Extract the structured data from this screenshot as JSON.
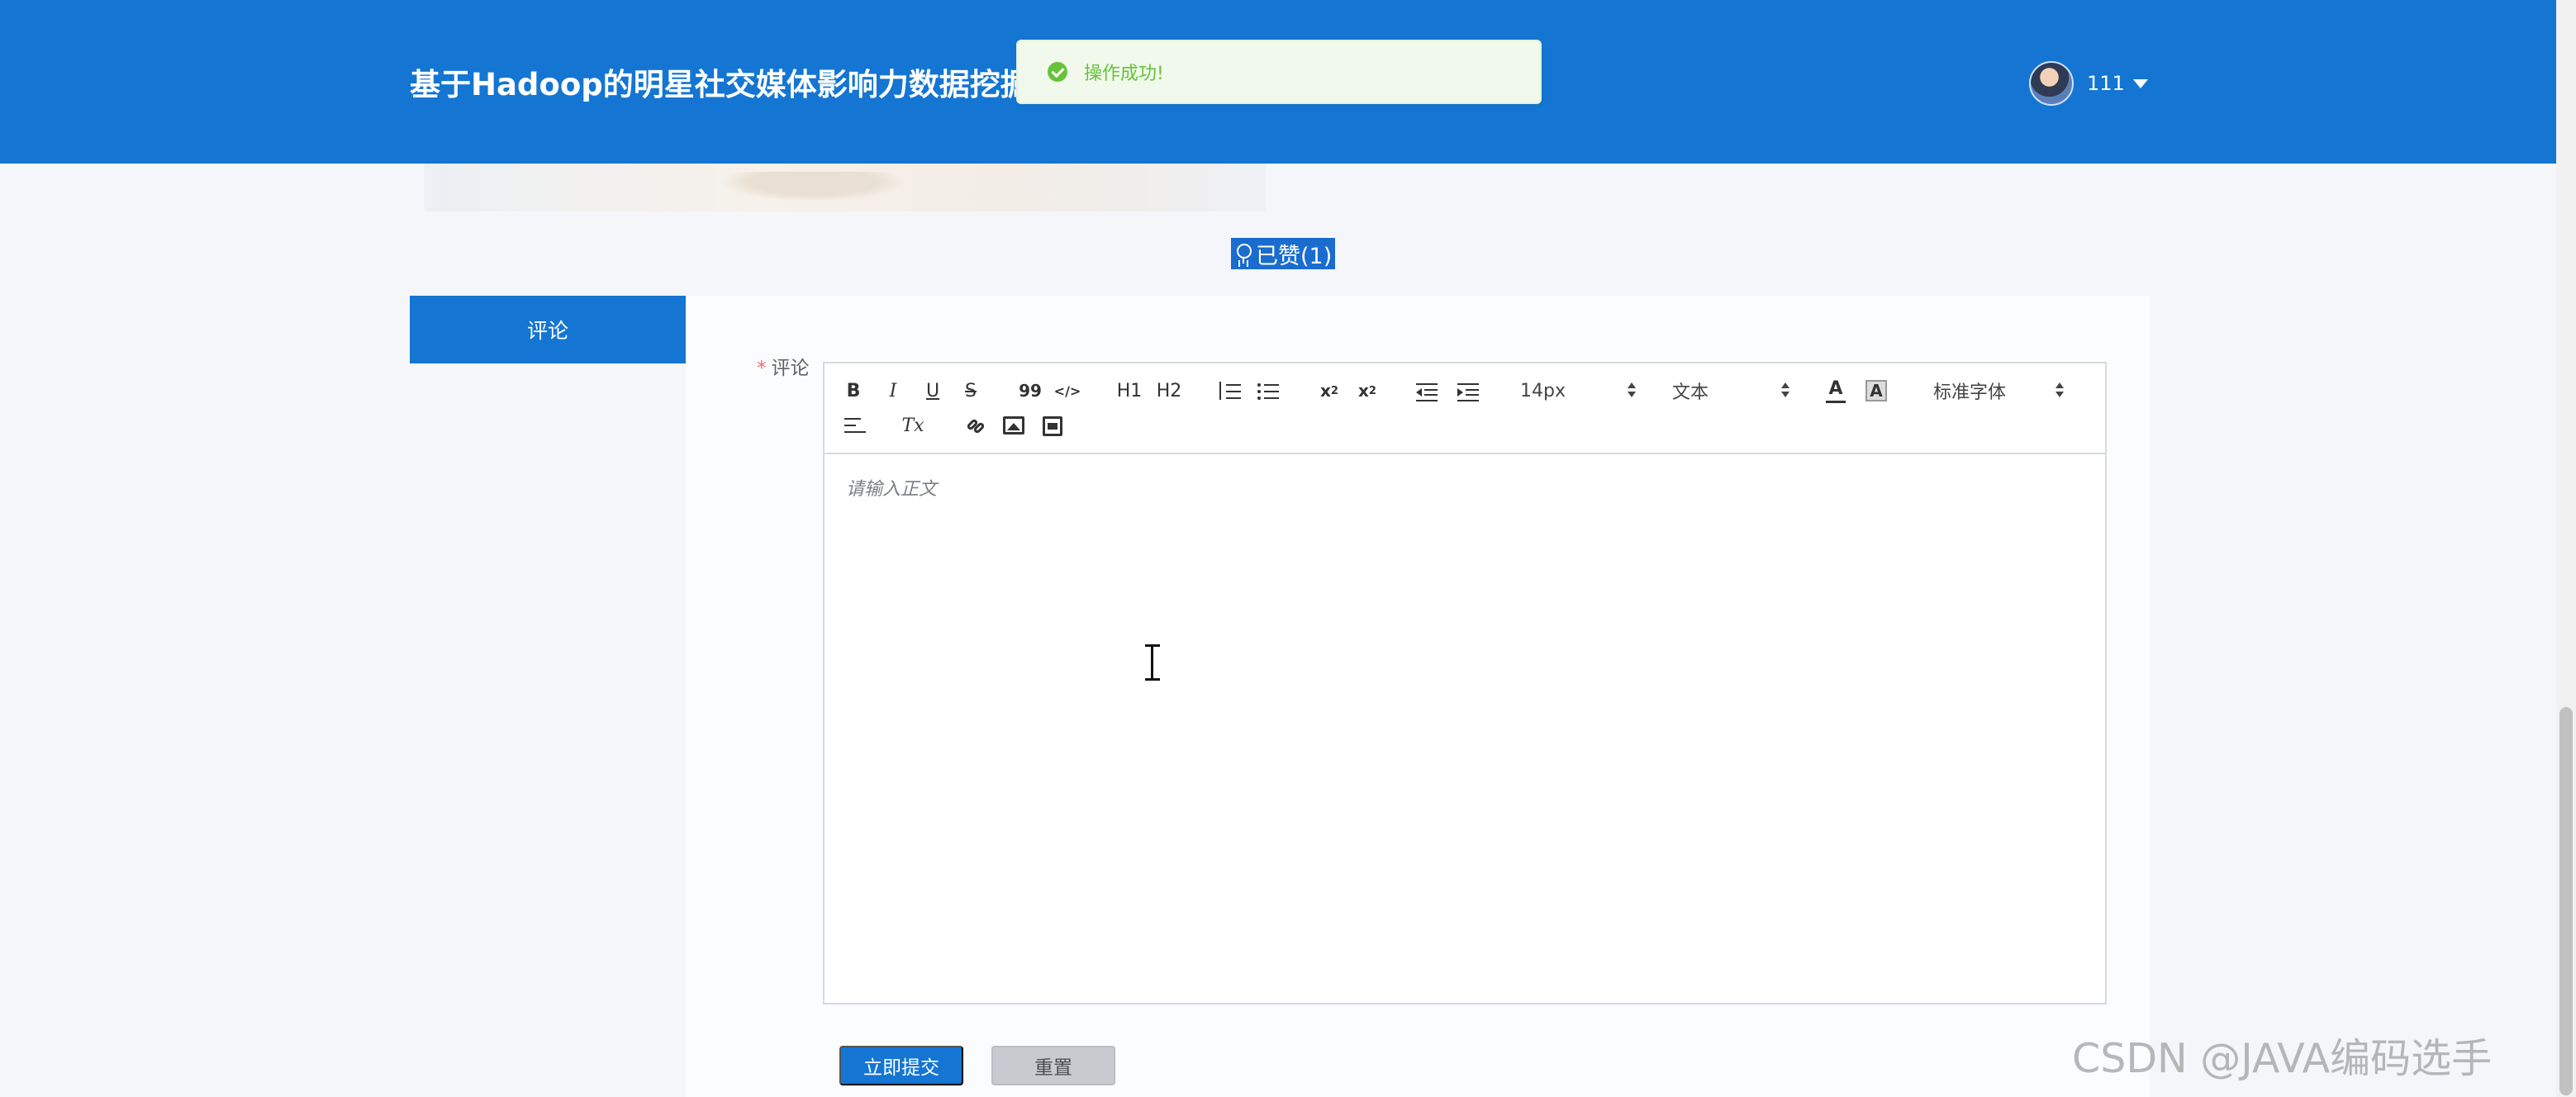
{
  "header": {
    "title": "基于Hadoop的明星社交媒体影响力数据挖掘",
    "username": "111"
  },
  "toast": {
    "message": "操作成功!"
  },
  "like": {
    "label": "已赞(1)"
  },
  "comment_tab": {
    "label": "评论"
  },
  "comment_form": {
    "label": "评论",
    "required_mark": "*",
    "placeholder": "请输入正文",
    "toolbar": {
      "bold": "B",
      "italic": "I",
      "underline": "U",
      "strike": "S",
      "blockquote": "99",
      "code": "</>",
      "h1": "H1",
      "h2": "H2",
      "subscript": "x2",
      "superscript": "x2",
      "font_size": "14px",
      "header_type": "文本",
      "font_family": "标准字体",
      "clean": "Tx"
    },
    "submit_label": "立即提交",
    "reset_label": "重置"
  },
  "watermark": "CSDN @JAVA编码选手",
  "colors": {
    "primary": "#1476d2",
    "success": "#67c23a",
    "danger": "#f56c6c"
  }
}
